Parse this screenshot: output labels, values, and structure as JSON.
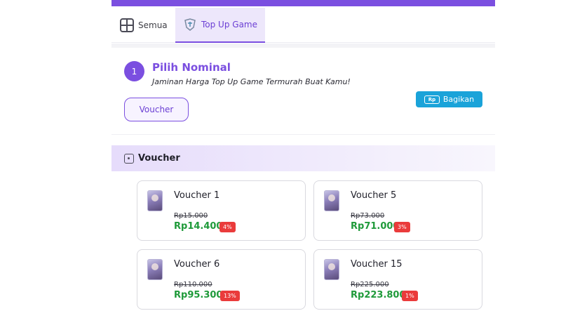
{
  "colors": {
    "accent": "#7b4fe0",
    "price_green": "#1f9a3a",
    "discount_red": "#ea3b3b",
    "share_blue": "#1aa3d9"
  },
  "tabs": [
    {
      "label": "Semua",
      "icon": "grid-icon"
    },
    {
      "label": "Top Up Game",
      "icon": "game-controller-icon",
      "active": true
    }
  ],
  "step": {
    "number": "1",
    "title": "Pilih Nominal",
    "subtitle": "Jaminan Harga Top Up Game Termurah Buat Kamu!",
    "category_button": "Voucher",
    "share_button": "Bagikan",
    "share_icon_text": "Rp"
  },
  "section": {
    "title": "Voucher",
    "icon": "voucher-icon"
  },
  "products": [
    {
      "name": "Voucher 1",
      "old_price": "Rp15.000",
      "price": "Rp14.400",
      "discount": "4%"
    },
    {
      "name": "Voucher 5",
      "old_price": "Rp73.000",
      "price": "Rp71.000",
      "discount": "3%"
    },
    {
      "name": "Voucher 6",
      "old_price": "Rp110.000",
      "price": "Rp95.300",
      "discount": "13%"
    },
    {
      "name": "Voucher 15",
      "old_price": "Rp225.000",
      "price": "Rp223.800",
      "discount": "1%"
    }
  ]
}
